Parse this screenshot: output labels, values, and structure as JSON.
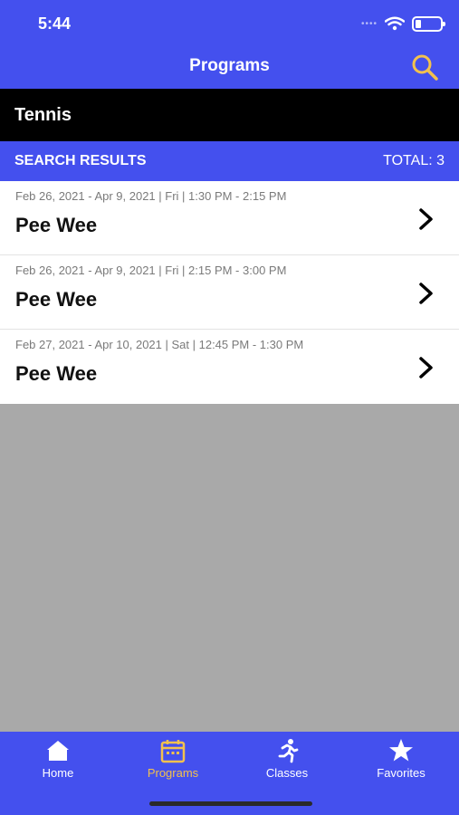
{
  "status_bar": {
    "time": "5:44",
    "battery_icon": "battery-icon",
    "wifi_icon": "wifi-icon"
  },
  "nav": {
    "title": "Programs",
    "search_icon": "search-icon",
    "accent_color": "#f2c14e"
  },
  "category": {
    "title": "Tennis"
  },
  "results": {
    "label": "SEARCH RESULTS",
    "total": "TOTAL: 3",
    "items": [
      {
        "meta": "Feb 26, 2021 - Apr 9, 2021 | Fri | 1:30 PM - 2:15 PM",
        "title": "Pee Wee"
      },
      {
        "meta": "Feb 26, 2021 - Apr 9, 2021 | Fri | 2:15 PM - 3:00 PM",
        "title": "Pee Wee"
      },
      {
        "meta": "Feb 27, 2021 - Apr 10, 2021 | Sat | 12:45 PM - 1:30 PM",
        "title": "Pee Wee"
      }
    ]
  },
  "tabs": [
    {
      "label": "Home",
      "icon": "home-icon",
      "active": false
    },
    {
      "label": "Programs",
      "icon": "calendar-icon",
      "active": true
    },
    {
      "label": "Classes",
      "icon": "runner-icon",
      "active": false
    },
    {
      "label": "Favorites",
      "icon": "star-icon",
      "active": false
    }
  ],
  "colors": {
    "primary": "#4450ee",
    "active_tab": "#f2c14e",
    "empty_area": "#a9a9a9"
  }
}
